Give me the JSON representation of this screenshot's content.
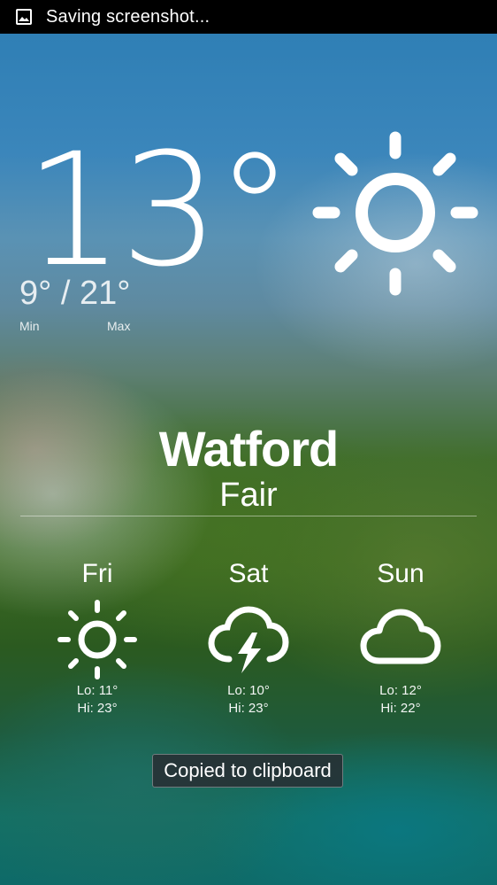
{
  "status_bar": {
    "icon": "image-icon",
    "text": "Saving screenshot..."
  },
  "current": {
    "temperature": "13°",
    "min_max": "9° / 21°",
    "min_label": "Min",
    "max_label": "Max",
    "icon": "sun-icon"
  },
  "location": {
    "city": "Watford",
    "condition": "Fair"
  },
  "forecast": [
    {
      "day": "Fri",
      "icon": "sun-icon",
      "lo": "Lo: 11°",
      "hi": "Hi: 23°"
    },
    {
      "day": "Sat",
      "icon": "thunderstorm-icon",
      "lo": "Lo: 10°",
      "hi": "Hi: 23°"
    },
    {
      "day": "Sun",
      "icon": "cloud-icon",
      "lo": "Lo: 12°",
      "hi": "Hi: 22°"
    }
  ],
  "toast": {
    "text": "Copied to clipboard"
  }
}
